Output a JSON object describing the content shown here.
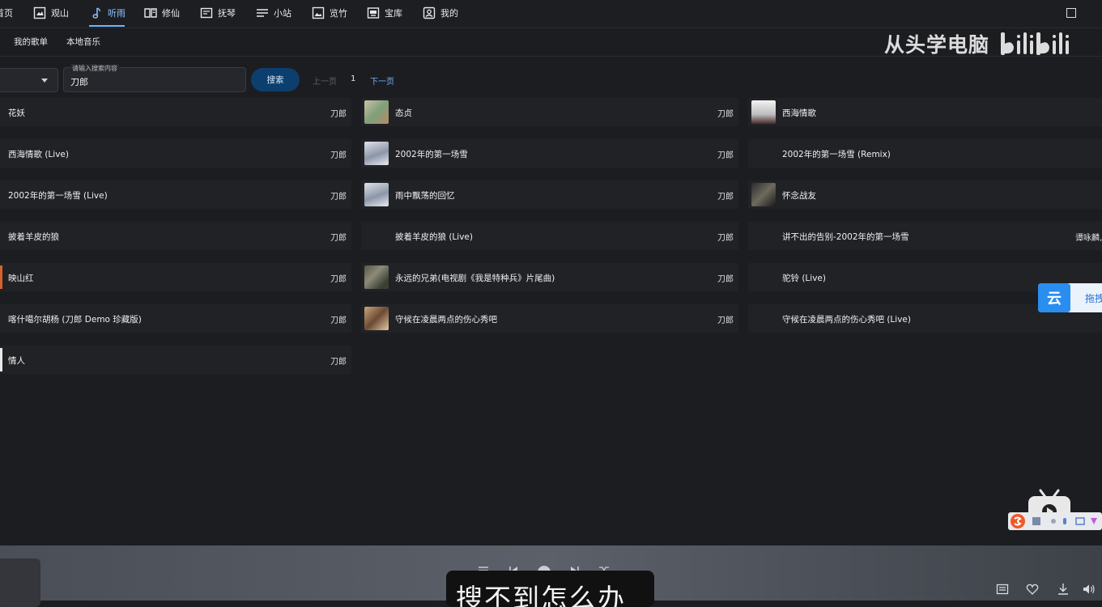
{
  "nav": {
    "items": [
      {
        "label": "首页",
        "icon": "home-icon"
      },
      {
        "label": "观山",
        "icon": "mountain-frame-icon"
      },
      {
        "label": "听雨",
        "icon": "music-note-icon"
      },
      {
        "label": "修仙",
        "icon": "book-icon"
      },
      {
        "label": "抚琴",
        "icon": "folder-icon"
      },
      {
        "label": "小站",
        "icon": "list-icon"
      },
      {
        "label": "览竹",
        "icon": "image-icon"
      },
      {
        "label": "宝库",
        "icon": "vault-icon"
      },
      {
        "label": "我的",
        "icon": "user-icon"
      }
    ],
    "active": "听雨"
  },
  "subnav": {
    "items": [
      "我的歌单",
      "本地音乐"
    ]
  },
  "watermark": {
    "text": "从头学电脑",
    "brand": "bilibili"
  },
  "search": {
    "label": "请输入搜索内容",
    "value": "刀郎",
    "button": "搜索",
    "prev": "上一页",
    "page": "1",
    "next": "下一页"
  },
  "songs": {
    "col1": [
      {
        "title": "花妖",
        "artist": "刀郎"
      },
      {
        "title": "西海情歌 (Live)",
        "artist": "刀郎"
      },
      {
        "title": "2002年的第一场雪 (Live)",
        "artist": "刀郎"
      },
      {
        "title": "披着羊皮的狼",
        "artist": "刀郎"
      },
      {
        "title": "映山红",
        "artist": "刀郎"
      },
      {
        "title": "喀什噶尔胡杨 (刀郎 Demo 珍藏版)",
        "artist": "刀郎"
      },
      {
        "title": "情人",
        "artist": "刀郎"
      }
    ],
    "col2": [
      {
        "title": "态贞",
        "artist": "刀郎"
      },
      {
        "title": "2002年的第一场雪",
        "artist": "刀郎"
      },
      {
        "title": "雨中飘荡的回忆",
        "artist": "刀郎"
      },
      {
        "title": "披着羊皮的狼 (Live)",
        "artist": "刀郎"
      },
      {
        "title": "永远的兄弟(电视剧《我是特种兵》片尾曲)",
        "artist": "刀郎"
      },
      {
        "title": "守候在凌晨两点的伤心秀吧",
        "artist": "刀郎"
      }
    ],
    "col3": [
      {
        "title": "西海情歌",
        "artist": ""
      },
      {
        "title": "2002年的第一场雪 (Remix)",
        "artist": ""
      },
      {
        "title": "怀念战友",
        "artist": ""
      },
      {
        "title": "讲不出的告别-2002年的第一场雪",
        "artist": "谭咏麟,"
      },
      {
        "title": "驼铃 (Live)",
        "artist": ""
      },
      {
        "title": "守候在凌晨两点的伤心秀吧 (Live)",
        "artist": ""
      }
    ]
  },
  "player": {
    "subtitle": "搜不到怎么办"
  },
  "floating": {
    "drag_label": "拖拽",
    "cloud_logo": "云"
  },
  "colors": {
    "accent": "#6fb5ff",
    "button_bg": "#0d3f6e",
    "background": "#1c1d21"
  }
}
